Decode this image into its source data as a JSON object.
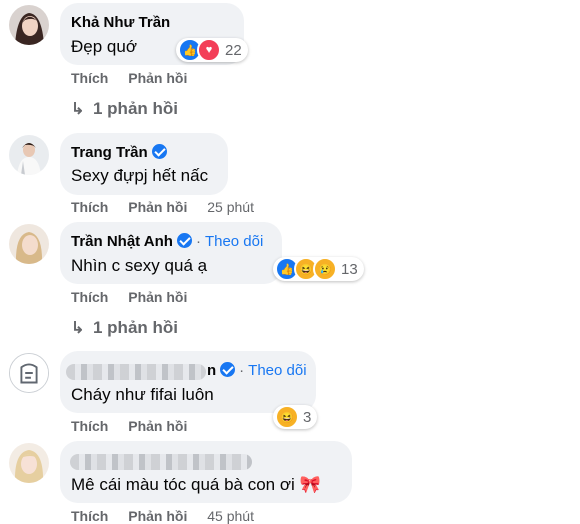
{
  "comments": [
    {
      "name": "Khả Như Trần",
      "verified": false,
      "text": "Đẹp quớ",
      "actions": {
        "like": "Thích",
        "reply": "Phản hồi",
        "time": ""
      },
      "reaction_count": "22",
      "reactions": [
        "like-icon",
        "love-icon"
      ],
      "replies_label": "1 phản hồi"
    },
    {
      "name": "Trang Trần",
      "verified": true,
      "text": "Sexy đựpj hết nấc",
      "actions": {
        "like": "Thích",
        "reply": "Phản hồi",
        "time": "25 phút"
      }
    },
    {
      "name": "Trần Nhật Anh",
      "verified": true,
      "follow": "Theo dõi",
      "text": "Nhìn c sexy quá ạ",
      "actions": {
        "like": "Thích",
        "reply": "Phản hồi",
        "time": ""
      },
      "reaction_count": "13",
      "reactions": [
        "like-icon",
        "haha-icon",
        "sad-icon"
      ],
      "replies_label": "1 phản hồi"
    },
    {
      "name": "",
      "name_visible_suffix": "n",
      "verified": true,
      "follow": "Theo dõi",
      "text": "Cháy như fifai luôn",
      "actions": {
        "like": "Thích",
        "reply": "Phản hồi",
        "time": ""
      },
      "reaction_count": "3",
      "reactions": [
        "haha-icon"
      ]
    },
    {
      "name": "",
      "verified": false,
      "text": "Mê cái màu tóc quá bà con ơi 🎀",
      "actions": {
        "like": "Thích",
        "reply": "Phản hồi",
        "time": "45 phút"
      }
    }
  ],
  "colors": {
    "bubble": "#f0f2f5",
    "link": "#1877f2",
    "secondary_text": "#65676b",
    "like": "#1877f2",
    "love": "#f33e58",
    "haha": "#f7b125"
  }
}
